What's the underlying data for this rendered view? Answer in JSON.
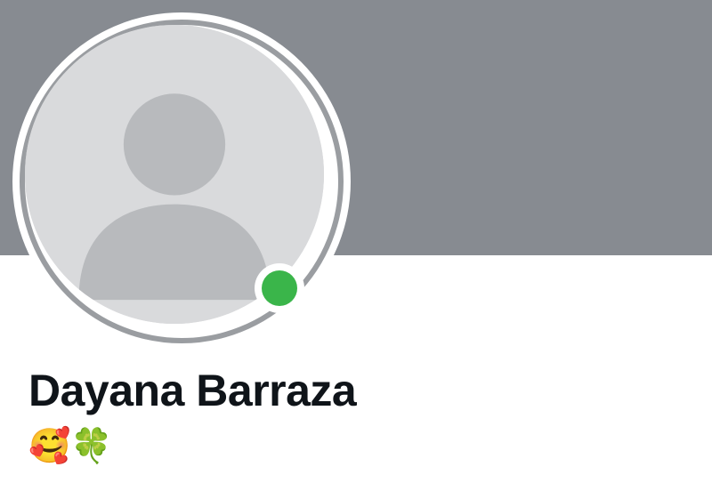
{
  "profile": {
    "display_name": "Dayana Barraza",
    "bio": "🥰🍀",
    "online_status": "online"
  },
  "colors": {
    "cover": "#878b91",
    "ring": "#9a9da1",
    "online": "#3ab54a",
    "name_text": "#0f1419"
  },
  "icons": {
    "avatar": "user-silhouette-placeholder",
    "online_indicator": "green-dot"
  }
}
